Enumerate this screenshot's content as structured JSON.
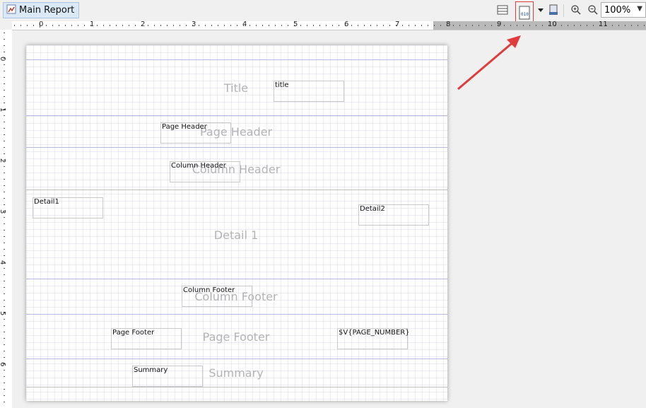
{
  "tab": {
    "label": "Main Report"
  },
  "zoom": {
    "value": "100%"
  },
  "ruler": {
    "h_labels": [
      "0",
      "1",
      "2",
      "3",
      "4",
      "5",
      "6",
      "7",
      "8",
      "9",
      "10",
      "11"
    ],
    "v_labels": [
      "0",
      "1",
      "2",
      "3",
      "4",
      "5",
      "6"
    ]
  },
  "bands": {
    "title": "Title",
    "page_header": "Page Header",
    "column_header": "Column Header",
    "detail": "Detail 1",
    "column_footer": "Column Footer",
    "page_footer": "Page Footer",
    "summary": "Summary"
  },
  "fields": {
    "title": "title",
    "page_header": "Page Header",
    "column_header": "Column Header",
    "detail1": "Detail1",
    "detail2": "Detail2",
    "column_footer": "Column Footer",
    "page_footer": "Page Footer",
    "page_number": "$V{PAGE_NUMBER}",
    "summary": "Summary"
  },
  "toolbar": {
    "icons": [
      "band-layout-icon",
      "show-xml-icon",
      "dropdown-arrow-icon",
      "export-icon",
      "zoom-in-icon",
      "zoom-out-icon"
    ]
  },
  "colors": {
    "highlight": "#e23b3b",
    "band_line": "#b8b8e0"
  }
}
